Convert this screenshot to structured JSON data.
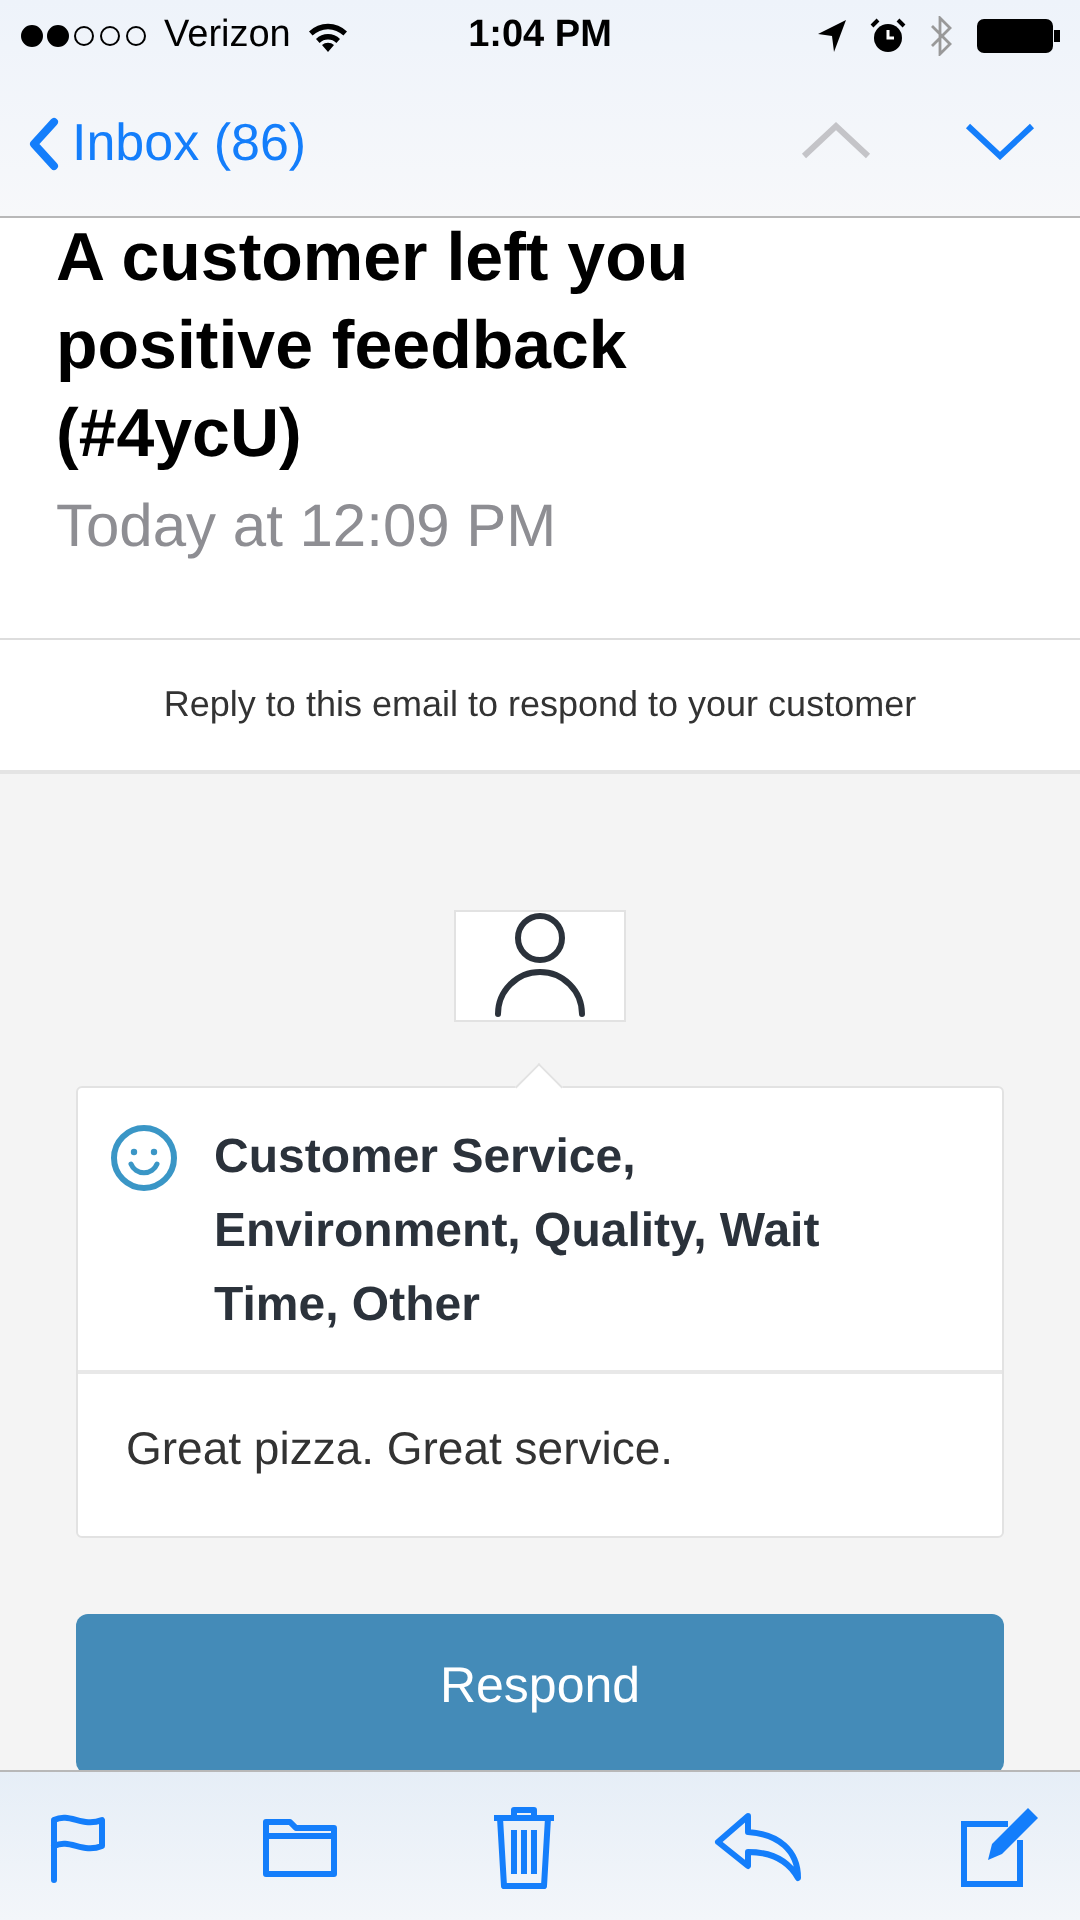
{
  "status_bar": {
    "carrier": "Verizon",
    "time": "1:04 PM"
  },
  "nav": {
    "back_label": "Inbox (86)",
    "previous": {
      "disabled": true
    },
    "next": {
      "disabled": false
    }
  },
  "message": {
    "subject": "A customer left you positive feedback (#4ycU)",
    "date": "Today at 12:09 PM",
    "notice": "Reply to this email to respond to your customer"
  },
  "feedback": {
    "categories": "Customer Service, Environment, Quality, Wait Time, Other",
    "comment": "Great pizza. Great service."
  },
  "respond_button": "Respond"
}
